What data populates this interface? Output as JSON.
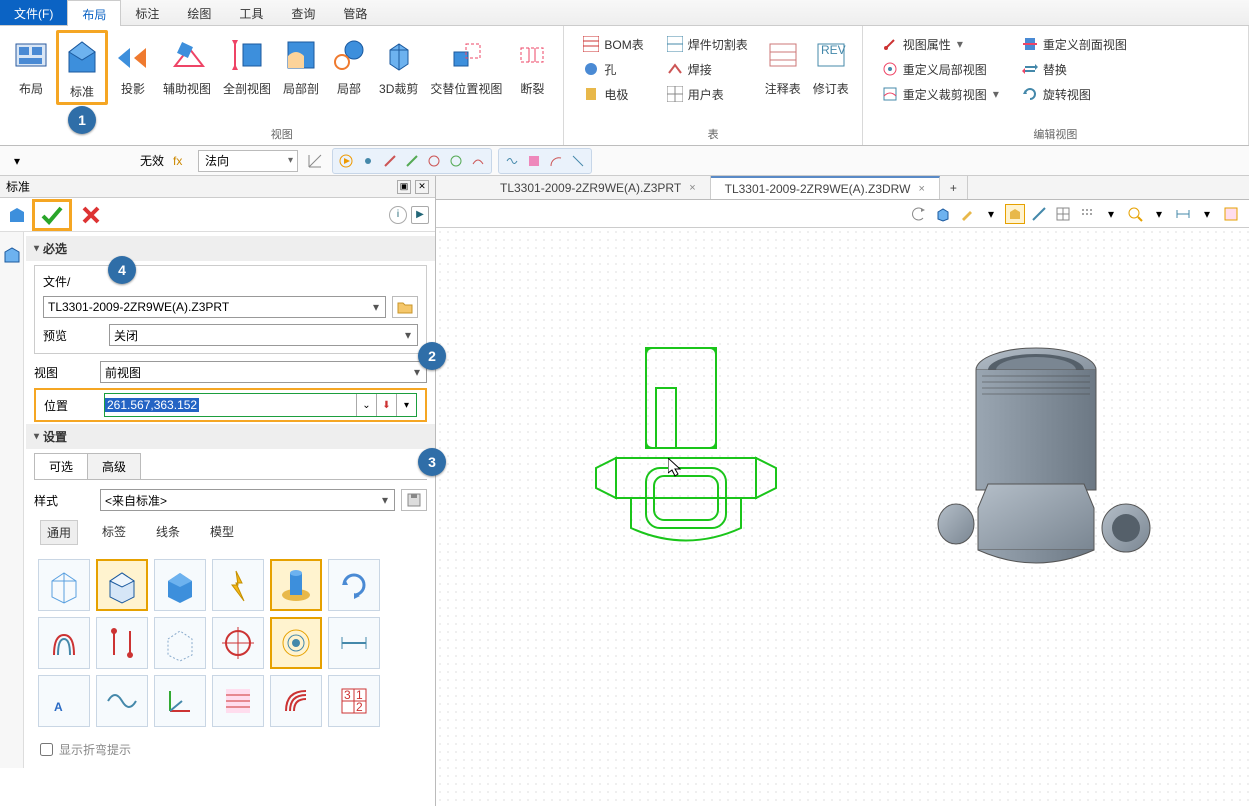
{
  "menu": {
    "file": "文件(F)",
    "items": [
      "布局",
      "标注",
      "绘图",
      "工具",
      "查询",
      "管路"
    ],
    "active": "布局"
  },
  "ribbon": {
    "view_group_label": "视图",
    "table_group_label": "表",
    "edit_group_label": "编辑视图",
    "btns": {
      "layout": "布局",
      "standard": "标准",
      "proj": "投影",
      "aux": "辅助视图",
      "fullsec": "全剖视图",
      "localsec": "局部剖",
      "local": "局部",
      "crop3d": "3D裁剪",
      "alt": "交替位置视图",
      "break": "断裂"
    },
    "table_btns": {
      "bom": "BOM表",
      "hole": "孔",
      "electrode": "电极",
      "weldcut": "焊件切割表",
      "weld": "焊接",
      "user": "用户表",
      "annot": "注释表",
      "rev": "修订表"
    },
    "edit_btns": {
      "props": "视图属性",
      "redef_local": "重定义局部视图",
      "redef_crop": "重定义裁剪视图",
      "redef_sec": "重定义剖面视图",
      "replace": "替换",
      "rotate": "旋转视图"
    }
  },
  "quickbar": {
    "invalid": "无效",
    "normal": "法向"
  },
  "panel": {
    "title": "标准",
    "section_required": "必选",
    "file_label": "文件/",
    "file_value": "TL3301-2009-2ZR9WE(A).Z3PRT",
    "preview_label": "预览",
    "preview_value": "关闭",
    "view_label": "视图",
    "view_value": "前视图",
    "pos_label": "位置",
    "pos_value": "261.567,363.152",
    "section_settings": "设置",
    "tab_optional": "可选",
    "tab_advanced": "高级",
    "style_label": "样式",
    "style_value": "<来自标准>",
    "tabs2": [
      "通用",
      "标签",
      "线条",
      "模型"
    ],
    "checkbox": "显示折弯提示"
  },
  "tabs": {
    "t1": "TL3301-2009-2ZR9WE(A).Z3PRT",
    "t2": "TL3301-2009-2ZR9WE(A).Z3DRW",
    "close": "×",
    "add": "+"
  },
  "callouts": {
    "c1": "1",
    "c2": "2",
    "c3": "3",
    "c4": "4"
  }
}
